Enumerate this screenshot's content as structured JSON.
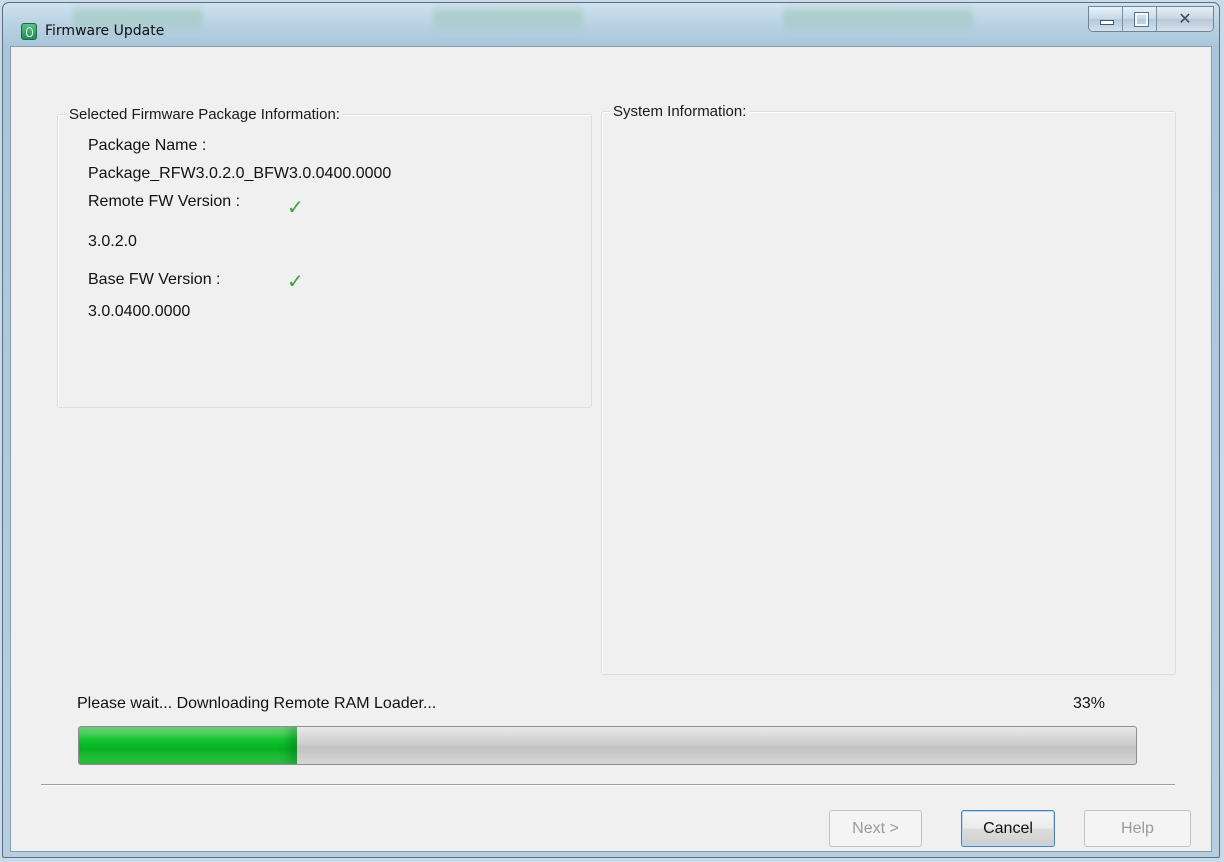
{
  "window": {
    "title": "Firmware Update",
    "icon": "firmware-app-icon",
    "controls": [
      "minimize-icon",
      "maximize-icon",
      "close-icon"
    ],
    "close_glyph": "✕"
  },
  "package_info": {
    "legend": "Selected Firmware Package Information:",
    "package_name_label": "Package Name :",
    "package_name_value": "Package_RFW3.0.2.0_BFW3.0.0400.0000",
    "remote_fw_label": "Remote FW Version :",
    "remote_fw_value": "3.0.2.0",
    "remote_fw_status_icon": "checkmark-icon",
    "base_fw_label": "Base FW Version :",
    "base_fw_value": "3.0.0400.0000",
    "base_fw_status_icon": "checkmark-icon",
    "check_glyph": "✓"
  },
  "system_info": {
    "legend": "System  Information:"
  },
  "progress": {
    "status_text": "Please wait... Downloading Remote RAM Loader...",
    "percent_text": "33%",
    "bar_fill_color": "#0fbd2b"
  },
  "buttons": {
    "next_label": "Next >",
    "next_enabled": false,
    "cancel_label": "Cancel",
    "cancel_enabled": true,
    "help_label": "Help",
    "help_enabled": false
  },
  "colors": {
    "success_check": "#39a53d",
    "window_frame": "#b9d2e3"
  }
}
